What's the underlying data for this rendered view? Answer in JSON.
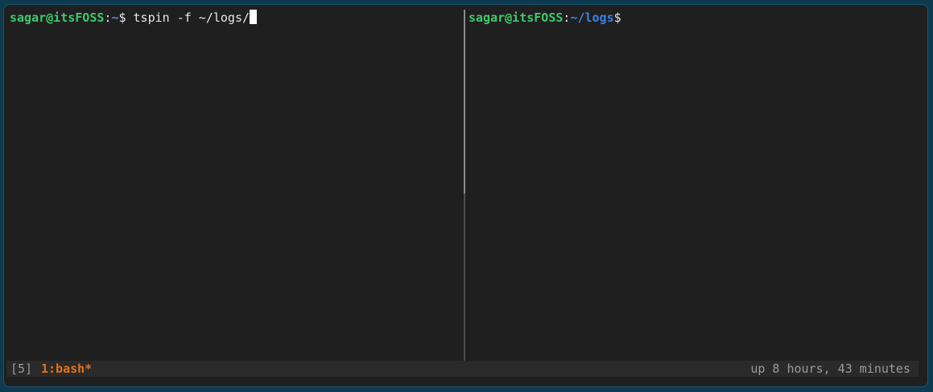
{
  "left_pane": {
    "user_host": "sagar@itsFOSS",
    "colon": ":",
    "path": "~",
    "prompt_symbol": "$",
    "command": " tspin -f ~/logs/"
  },
  "right_pane": {
    "user_host": "sagar@itsFOSS",
    "colon": ":",
    "path": "~/logs",
    "prompt_symbol": "$"
  },
  "status_bar": {
    "session": "[5]",
    "window": "1:bash*",
    "uptime": "up 8 hours, 43 minutes"
  },
  "colors": {
    "user_host": "#3ec96b",
    "path": "#3a84e0",
    "active_window": "#e3731c",
    "terminal_bg": "#1f1f1f"
  }
}
